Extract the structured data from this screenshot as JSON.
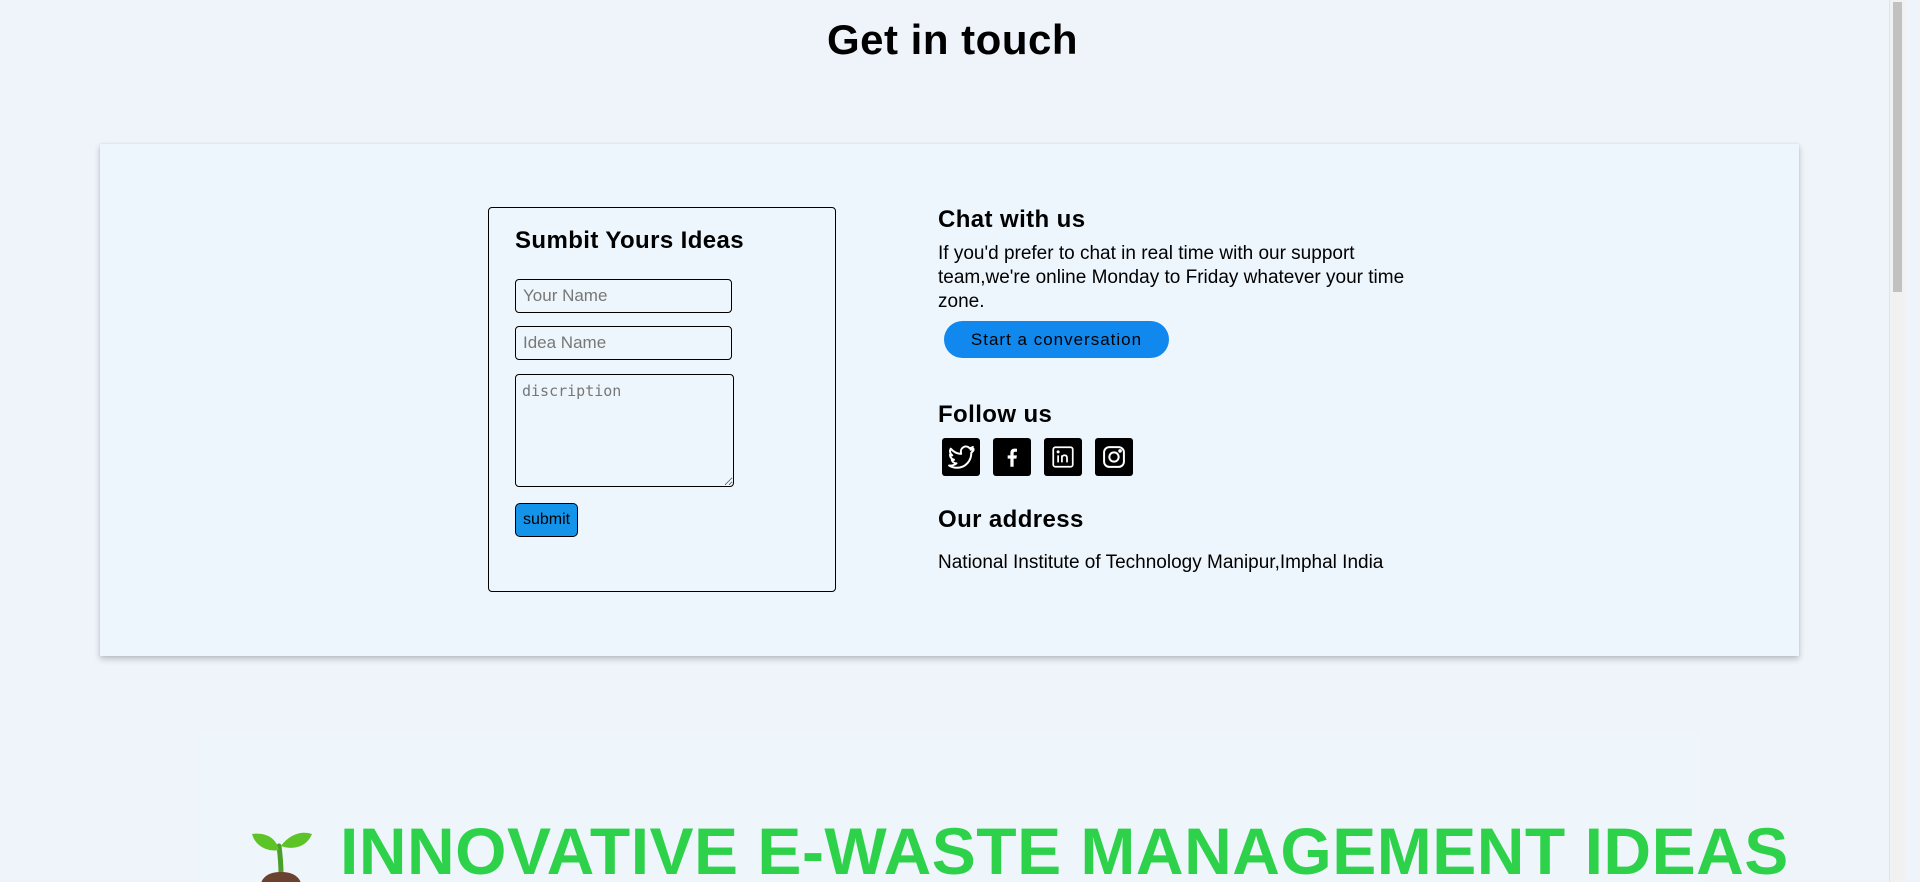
{
  "page": {
    "heading": "Get in touch"
  },
  "form": {
    "title": "Sumbit Yours Ideas",
    "name_placeholder": "Your Name",
    "name_value": "",
    "idea_placeholder": "Idea Name",
    "idea_value": "",
    "description_placeholder": "discription",
    "description_value": "",
    "submit_label": "submit"
  },
  "chat": {
    "heading": "Chat with us",
    "text": "If you'd prefer to chat in real time with our support team,we're online Monday to Friday whatever your time zone.",
    "button_label": "Start a conversation"
  },
  "follow": {
    "heading": "Follow us",
    "icons": [
      "twitter-icon",
      "facebook-icon",
      "linkedin-icon",
      "instagram-icon"
    ]
  },
  "address": {
    "heading": "Our address",
    "text": "National Institute of Technology Manipur,Imphal India"
  },
  "hero": {
    "title": "INNOVATIVE E-WASTE MANAGEMENT IDEAS",
    "icon": "sprout-icon"
  },
  "colors": {
    "background": "#eef4fa",
    "button_blue": "#1188ee",
    "submit_blue": "#1394ea",
    "hero_green": "#2ed24a"
  }
}
